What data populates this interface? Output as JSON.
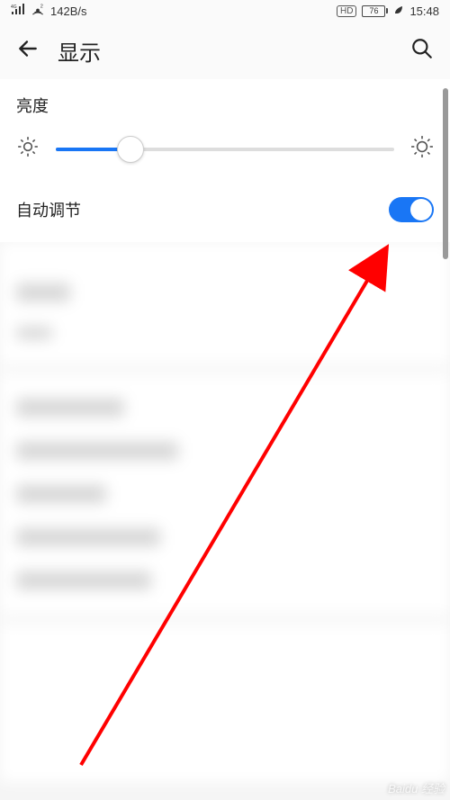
{
  "status_bar": {
    "network_speed": "142B/s",
    "hd": "HD",
    "battery_pct": "76",
    "time": "15:48"
  },
  "header": {
    "title": "显示"
  },
  "brightness": {
    "label": "亮度",
    "value_pct": 22
  },
  "auto_adjust": {
    "label": "自动调节",
    "enabled": true
  },
  "watermark": "Baidu 经验"
}
